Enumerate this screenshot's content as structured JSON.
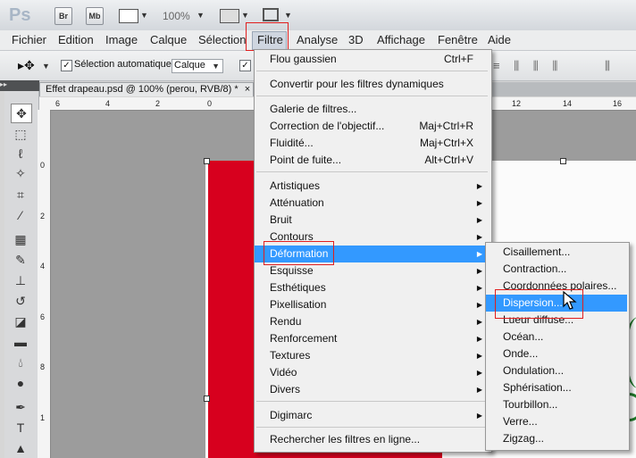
{
  "app": {
    "logo": "Ps",
    "buttons": [
      "Br",
      "Mb"
    ],
    "zoom": "100%"
  },
  "menubar": {
    "items": [
      "Fichier",
      "Edition",
      "Image",
      "Calque",
      "Sélection",
      "Filtre",
      "Analyse",
      "3D",
      "Affichage",
      "Fenêtre",
      "Aide"
    ],
    "active": "Filtre"
  },
  "options": {
    "auto_select_label": "Sélection automatique :",
    "auto_select_value": "Calque",
    "checkbox_checked": "✓"
  },
  "document": {
    "tab_title": "Effet drapeau.psd @ 100% (perou, RVB/8) *",
    "close_symbol": "×",
    "ruler_top": [
      "6",
      "4",
      "2",
      "0",
      "12",
      "14",
      "16"
    ],
    "ruler_left": [
      "0",
      "2",
      "4",
      "6",
      "8",
      "1"
    ]
  },
  "filter_menu": {
    "top_items": [
      {
        "label": "Flou gaussien",
        "shortcut": "Ctrl+F"
      },
      {
        "label": "Convertir pour les filtres dynamiques",
        "shortcut": ""
      }
    ],
    "group2": [
      {
        "label": "Galerie de filtres...",
        "shortcut": ""
      },
      {
        "label": "Correction de l'objectif...",
        "shortcut": "Maj+Ctrl+R"
      },
      {
        "label": "Fluidité...",
        "shortcut": "Maj+Ctrl+X"
      },
      {
        "label": "Point de fuite...",
        "shortcut": "Alt+Ctrl+V"
      }
    ],
    "submenus": [
      "Artistiques",
      "Atténuation",
      "Bruit",
      "Contours",
      "Déformation",
      "Esquisse",
      "Esthétiques",
      "Pixellisation",
      "Rendu",
      "Renforcement",
      "Textures",
      "Vidéo",
      "Divers"
    ],
    "highlighted": "Déformation",
    "group4": [
      "Digimarc"
    ],
    "online": "Rechercher les filtres en ligne..."
  },
  "sub_menu": {
    "items": [
      "Cisaillement...",
      "Contraction...",
      "Coordonnées polaires...",
      "Dispersion...",
      "Lueur diffuse...",
      "Océan...",
      "Onde...",
      "Ondulation...",
      "Sphérisation...",
      "Tourbillon...",
      "Verre...",
      "Zigzag..."
    ],
    "highlighted": "Dispersion..."
  },
  "colors": {
    "highlight": "#3399ff",
    "annotation_red": "#e01e1e",
    "flag_red": "#d7001e"
  },
  "icons": {
    "cursor": "pointer-arrow-icon",
    "submenu_arrow": "▶"
  }
}
